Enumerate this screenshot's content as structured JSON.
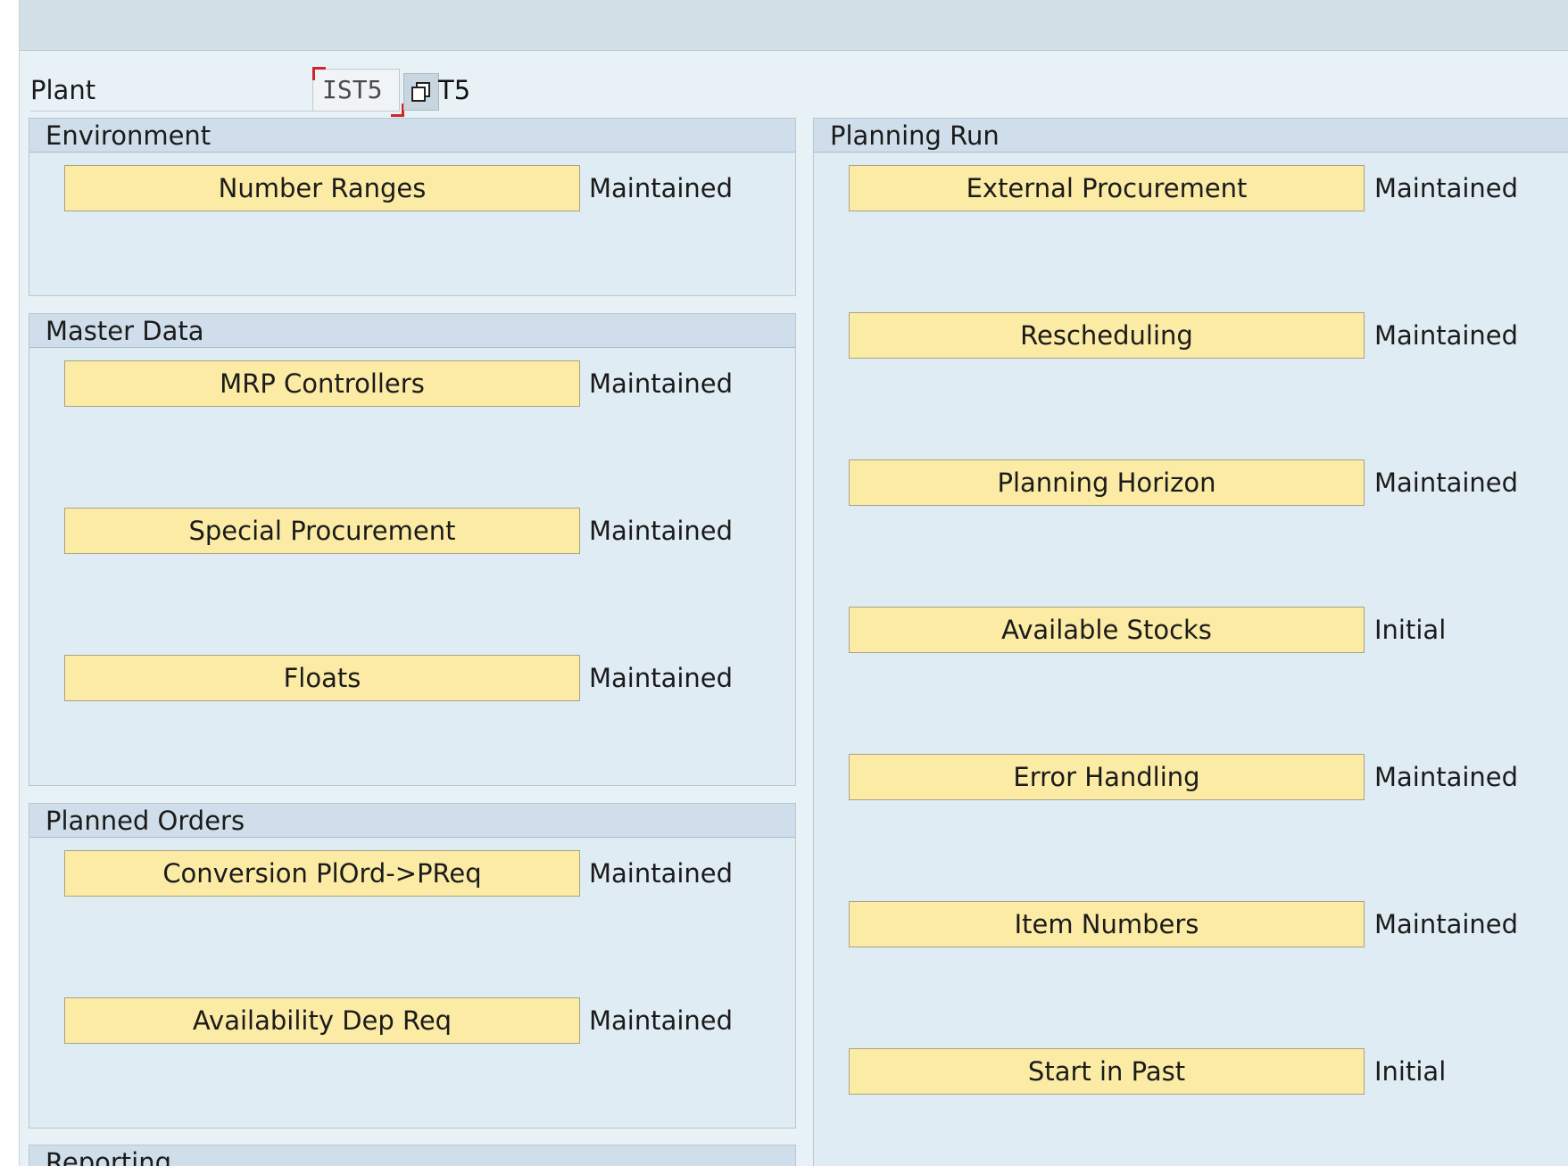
{
  "plant": {
    "label": "Plant",
    "input_value": "IST5",
    "value_text": "T5"
  },
  "icons": {
    "copy": "copy-icon"
  },
  "environment": {
    "title": "Environment",
    "items": [
      {
        "label": "Number Ranges",
        "status": "Maintained"
      }
    ]
  },
  "master_data": {
    "title": "Master Data",
    "items": [
      {
        "label": "MRP Controllers",
        "status": "Maintained"
      },
      {
        "label": "Special Procurement",
        "status": "Maintained"
      },
      {
        "label": "Floats",
        "status": "Maintained"
      }
    ]
  },
  "planned_orders": {
    "title": "Planned Orders",
    "items": [
      {
        "label": "Conversion PlOrd->PReq",
        "status": "Maintained"
      },
      {
        "label": "Availability Dep Req",
        "status": "Maintained"
      }
    ]
  },
  "reporting": {
    "title": "Reporting"
  },
  "planning_run": {
    "title": "Planning Run",
    "items": [
      {
        "label": "External Procurement",
        "status": "Maintained"
      },
      {
        "label": "Rescheduling",
        "status": "Maintained"
      },
      {
        "label": "Planning Horizon",
        "status": "Maintained"
      },
      {
        "label": "Available Stocks",
        "status": "Initial"
      },
      {
        "label": "Error Handling",
        "status": "Maintained"
      },
      {
        "label": "Item Numbers",
        "status": "Maintained"
      },
      {
        "label": "Start in Past",
        "status": "Initial"
      }
    ]
  },
  "colors": {
    "button_bg": "#fbeba4",
    "group_bg": "#e0ecf4",
    "header_bg": "#cfdeea",
    "focus": "#d0262a"
  }
}
